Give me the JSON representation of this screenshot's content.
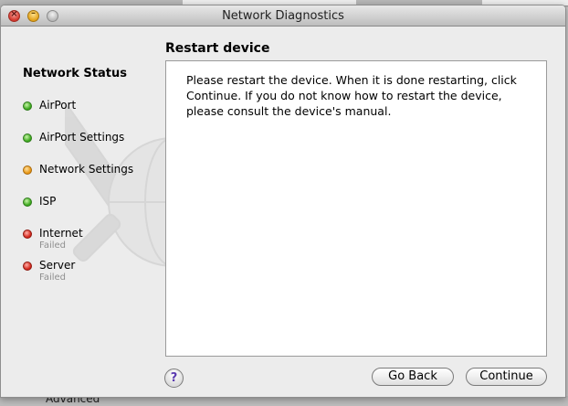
{
  "background": {
    "bottom_text": "Advanced"
  },
  "window": {
    "title": "Network Diagnostics",
    "controls": {
      "close_glyph": "×",
      "minimize_glyph": "–"
    }
  },
  "sidebar": {
    "heading": "Network Status",
    "items": [
      {
        "label": "AirPort",
        "status": "green",
        "sub": ""
      },
      {
        "label": "AirPort Settings",
        "status": "green",
        "sub": ""
      },
      {
        "label": "Network Settings",
        "status": "orange",
        "sub": ""
      },
      {
        "label": "ISP",
        "status": "green",
        "sub": ""
      },
      {
        "label": "Internet",
        "status": "red",
        "sub": "Failed"
      },
      {
        "label": "Server",
        "status": "red",
        "sub": "Failed"
      }
    ]
  },
  "main": {
    "title": "Restart device",
    "message": "Please restart the device. When it is done restarting, click Continue. If you do not know how to restart the device, please consult the device's manual."
  },
  "footer": {
    "help_label": "?",
    "back_label": "Go Back",
    "continue_label": "Continue"
  },
  "colors": {
    "green": "#3aa71c",
    "orange": "#e79512",
    "red": "#d3261b"
  }
}
